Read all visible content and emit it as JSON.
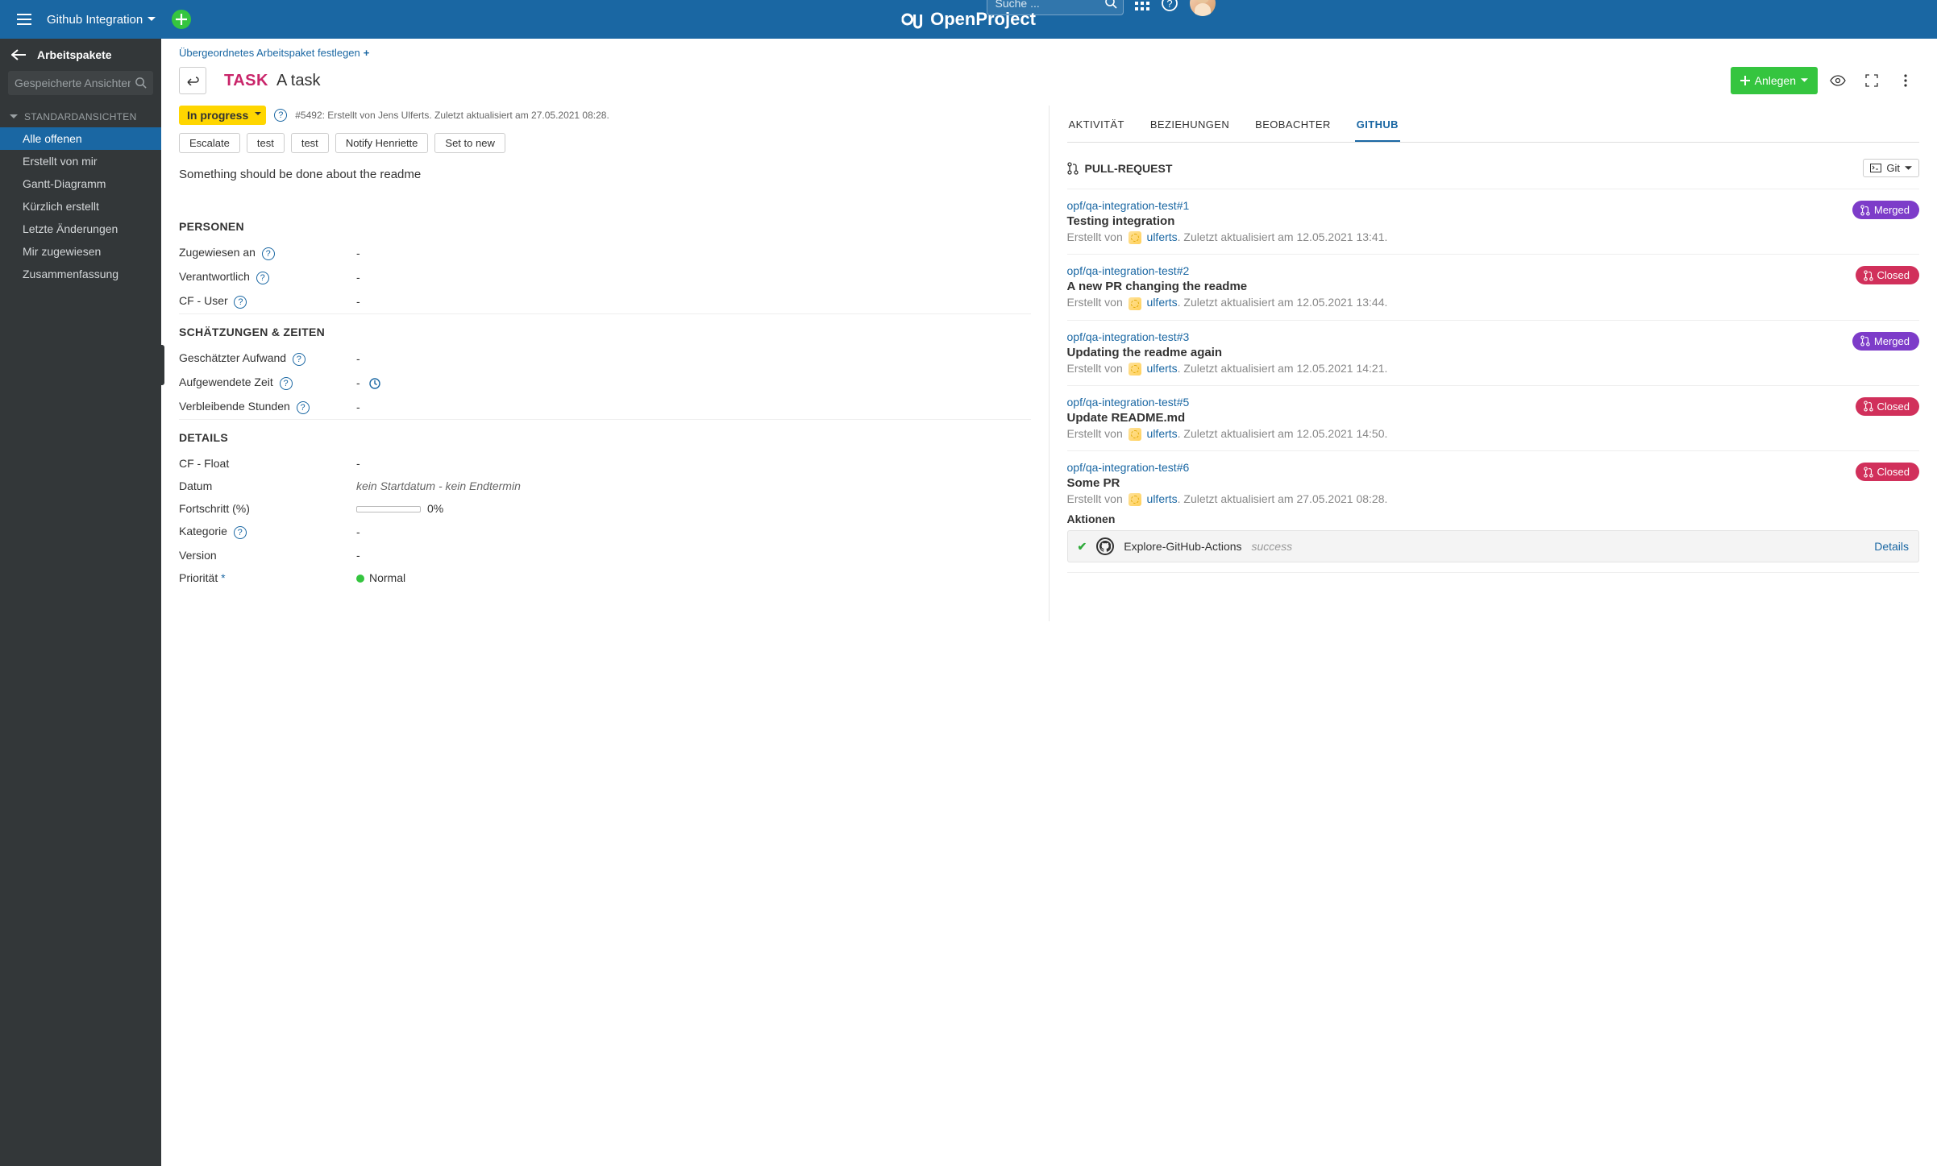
{
  "header": {
    "project_name": "Github Integration",
    "logo_text": "OpenProject",
    "search_placeholder": "Suche ..."
  },
  "sidebar": {
    "title": "Arbeitspakete",
    "search_placeholder": "Gespeicherte Ansichten ...",
    "section": "STANDARDANSICHTEN",
    "items": [
      {
        "label": "Alle offenen",
        "active": true
      },
      {
        "label": "Erstellt von mir"
      },
      {
        "label": "Gantt-Diagramm"
      },
      {
        "label": "Kürzlich erstellt"
      },
      {
        "label": "Letzte Änderungen"
      },
      {
        "label": "Mir zugewiesen"
      },
      {
        "label": "Zusammenfassung"
      }
    ]
  },
  "wp": {
    "parent_label": "Übergeordnetes Arbeitspaket festlegen",
    "type": "TASK",
    "subject": "A task",
    "create_btn": "Anlegen",
    "status": "In progress",
    "meta": "#5492: Erstellt von Jens Ulferts. Zuletzt aktualisiert am 27.05.2021 08:28.",
    "actions": [
      "Escalate",
      "test",
      "test",
      "Notify Henriette",
      "Set to new"
    ],
    "description": "Something should be done about the readme",
    "sections": {
      "personen": {
        "title": "PERSONEN",
        "fields": [
          {
            "label": "Zugewiesen an",
            "help": true,
            "value": "-"
          },
          {
            "label": "Verantwortlich",
            "help": true,
            "value": "-"
          },
          {
            "label": "CF - User",
            "help": true,
            "value": "-"
          }
        ]
      },
      "zeiten": {
        "title": "SCHÄTZUNGEN & ZEITEN",
        "fields": [
          {
            "label": "Geschätzter Aufwand",
            "help": true,
            "value": "-"
          },
          {
            "label": "Aufgewendete Zeit",
            "help": true,
            "value": "-",
            "clock": true
          },
          {
            "label": "Verbleibende Stunden",
            "help": true,
            "value": "-"
          }
        ]
      },
      "details": {
        "title": "DETAILS",
        "fields": [
          {
            "label": "CF - Float",
            "value": "-"
          },
          {
            "label": "Datum",
            "value": "kein Startdatum - kein Endtermin",
            "italic": true
          },
          {
            "label": "Fortschritt (%)",
            "progress": "0%"
          },
          {
            "label": "Kategorie",
            "help": true,
            "value": "-"
          },
          {
            "label": "Version",
            "value": "-"
          },
          {
            "label": "Priorität",
            "required": true,
            "priority": "Normal"
          }
        ]
      }
    }
  },
  "rightPane": {
    "tabs": [
      "AKTIVITÄT",
      "BEZIEHUNGEN",
      "BEOBACHTER",
      "GITHUB"
    ],
    "active_tab": "GITHUB",
    "pr_section_title": "PULL-REQUEST",
    "git_dropdown": "Git",
    "prs": [
      {
        "repo": "opf/qa-integration-test#1",
        "title": "Testing integration",
        "created": "Erstellt von",
        "user": "ulferts",
        "updated": ". Zuletzt aktualisiert am 12.05.2021 13:41.",
        "state": "Merged",
        "kind": "merged"
      },
      {
        "repo": "opf/qa-integration-test#2",
        "title": "A new PR changing the readme",
        "created": "Erstellt von",
        "user": "ulferts",
        "updated": ". Zuletzt aktualisiert am 12.05.2021 13:44.",
        "state": "Closed",
        "kind": "closed"
      },
      {
        "repo": "opf/qa-integration-test#3",
        "title": "Updating the readme again",
        "created": "Erstellt von",
        "user": "ulferts",
        "updated": ". Zuletzt aktualisiert am 12.05.2021 14:21.",
        "state": "Merged",
        "kind": "merged"
      },
      {
        "repo": "opf/qa-integration-test#5",
        "title": "Update README.md",
        "created": "Erstellt von",
        "user": "ulferts",
        "updated": ". Zuletzt aktualisiert am 12.05.2021 14:50.",
        "state": "Closed",
        "kind": "closed"
      },
      {
        "repo": "opf/qa-integration-test#6",
        "title": "Some PR",
        "created": "Erstellt von",
        "user": "ulferts",
        "updated": ". Zuletzt aktualisiert am 27.05.2021 08:28.",
        "state": "Closed",
        "kind": "closed",
        "actions_label": "Aktionen",
        "action": {
          "name": "Explore-GitHub-Actions",
          "status": "success",
          "details": "Details"
        }
      }
    ]
  }
}
